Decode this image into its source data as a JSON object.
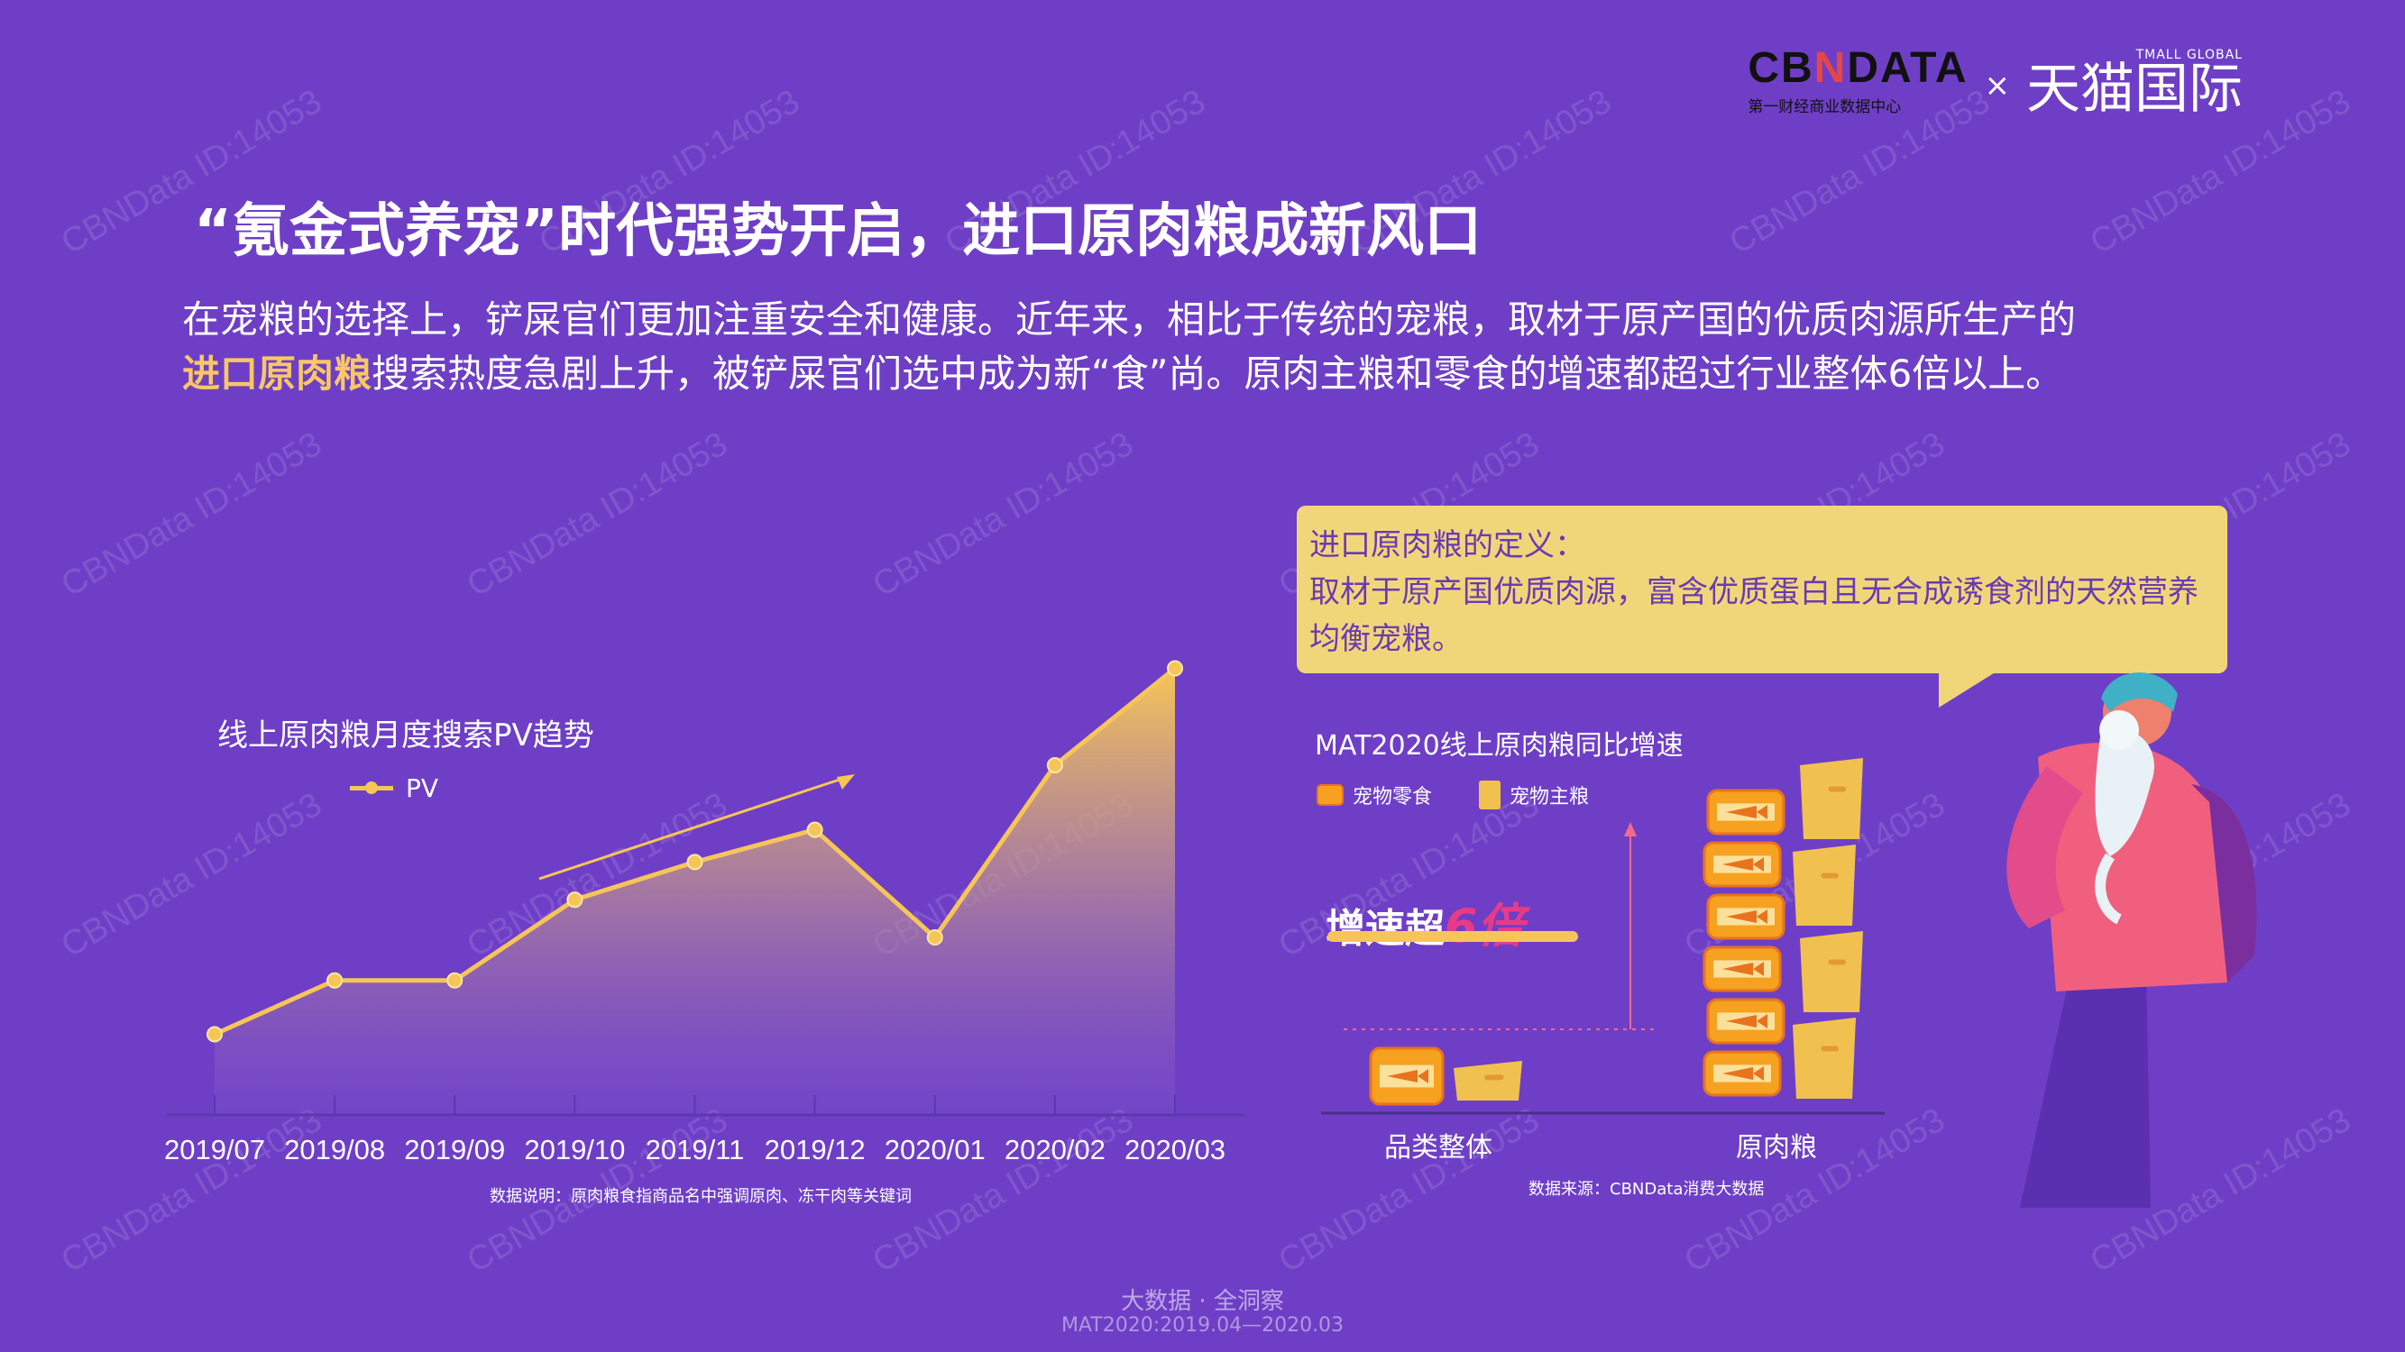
{
  "logos": {
    "cbndata_pre": "CB",
    "cbndata_n": "N",
    "cbndata_post": "DATA",
    "cbndata_sub": "第一财经商业数据中心",
    "separator": "×",
    "tmall_small": "TMALL GLOBAL",
    "tmall_cn": "天猫国际"
  },
  "watermark": "CBNData ID:14053",
  "title": "“氪金式养宠”时代强势开启，进口原肉粮成新风口",
  "description": {
    "line1": "在宠粮的选择上，铲屎官们更加注重安全和健康。近年来，相比于传统的宠粮，取材于原产国的优质肉源所生产的",
    "highlight": "进口原肉粮",
    "line2_rest": "搜索热度急剧上升，被铲屎官们选中成为新“食”尚。原肉主粮和零食的增速都超过行业整体6倍以上。"
  },
  "definition": {
    "heading": "进口原肉粮的定义：",
    "body": "取材于原产国优质肉源，富含优质蛋白且无合成诱食剂的天然营养均衡宠粮。"
  },
  "chart_data": [
    {
      "type": "area",
      "title": "线上原肉粮月度搜索PV趋势",
      "series": [
        {
          "name": "PV",
          "color": "#f6c557",
          "values": [
            15,
            25,
            25,
            40,
            47,
            53,
            33,
            65,
            83
          ]
        }
      ],
      "categories": [
        "2019/07",
        "2019/08",
        "2019/09",
        "2019/10",
        "2019/11",
        "2019/12",
        "2020/01",
        "2020/02",
        "2020/03"
      ],
      "ylim": [
        0,
        100
      ],
      "yaxis_labeled": false,
      "grid": false,
      "legend": "top-left",
      "note": "数据说明：原肉粮食指商品名中强调原肉、冻干肉等关键词"
    },
    {
      "type": "bar",
      "title": "MAT2020线上原肉粮同比增速",
      "categories": [
        "品类整体",
        "原肉粮"
      ],
      "series": [
        {
          "name": "宠物零食",
          "color": "#f6a11f",
          "values": [
            1,
            6
          ]
        },
        {
          "name": "宠物主粮",
          "color": "#f1c14f",
          "values": [
            1,
            6
          ]
        }
      ],
      "annotation_pre": "增速超",
      "annotation_num": "6倍",
      "legend": "top-left",
      "note": "数据来源：CBNData消费大数据"
    }
  ],
  "footer": {
    "line1": "大数据 · 全洞察",
    "line2": "MAT2020:2019.04—2020.03"
  },
  "colors": {
    "background": "#6e3fc6",
    "accent": "#f6c557",
    "bubble": "#f1d679",
    "highlight": "#e73b86"
  }
}
